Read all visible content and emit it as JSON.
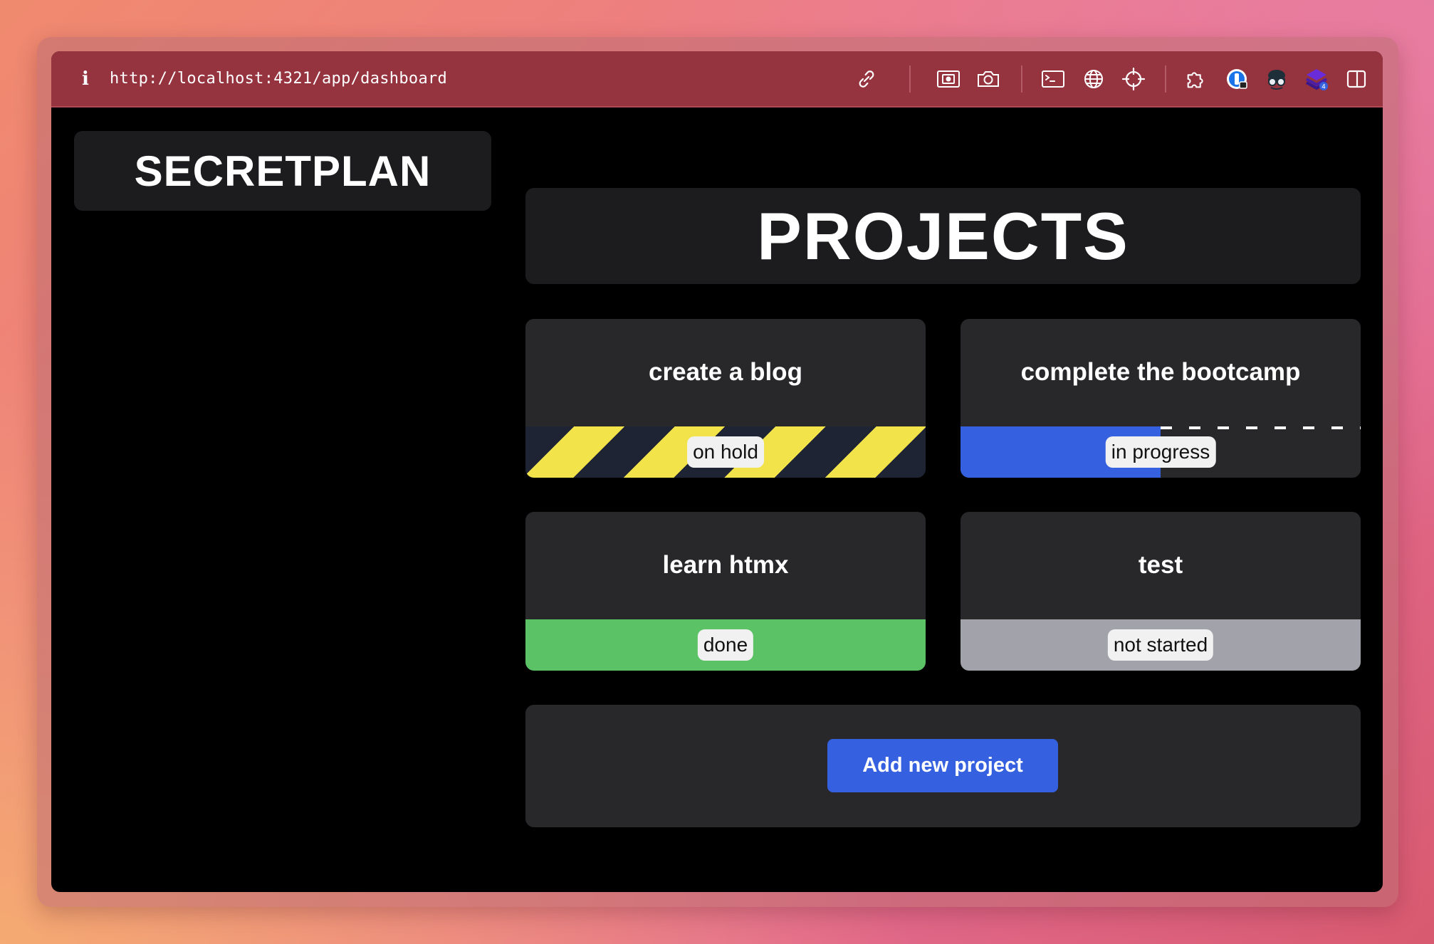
{
  "browser": {
    "url": "http://localhost:4321/app/dashboard",
    "toolbar_icons": [
      "info-icon",
      "link-icon",
      "screenshot-region-icon",
      "camera-icon",
      "terminal-icon",
      "globe-icon",
      "crosshair-icon",
      "extensions-icon",
      "password-manager-icon",
      "spy-extension-icon",
      "stack-extension-icon",
      "sidebar-toggle-icon"
    ],
    "extension_badge": "4"
  },
  "app": {
    "logo": "SECRETPLAN",
    "page_title": "PROJECTS",
    "projects": [
      {
        "name": "create a blog",
        "status": "on hold"
      },
      {
        "name": "complete the bootcamp",
        "status": "in progress",
        "progress": 0.5
      },
      {
        "name": "learn htmx",
        "status": "done"
      },
      {
        "name": "test",
        "status": "not started"
      }
    ],
    "add_button": "Add new project"
  },
  "colors": {
    "toolbar": "#95333f",
    "panel": "#1c1c1e",
    "card": "#28282b",
    "accent_blue": "#3561e0",
    "hold_yellow": "#f2e34a",
    "hold_dark": "#1e2433",
    "done_green": "#5cc266",
    "not_started_gray": "#a2a3aa"
  }
}
